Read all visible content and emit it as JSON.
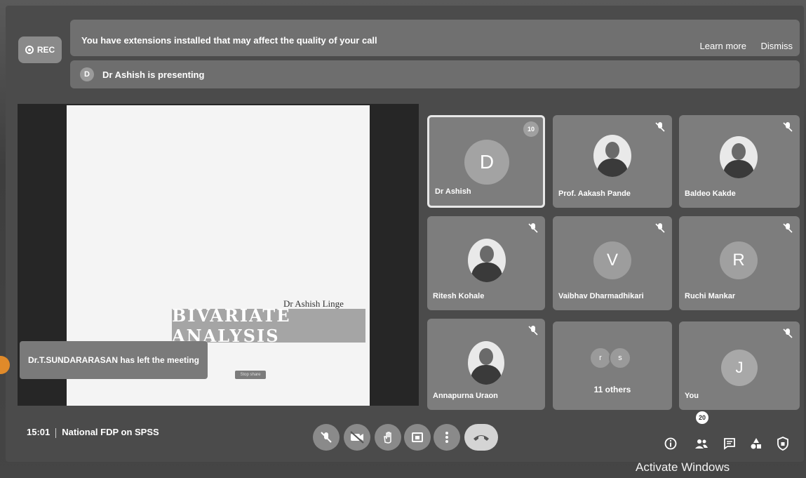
{
  "recording": {
    "label": "REC"
  },
  "banner": {
    "message": "You have extensions installed that may affect the quality of your call",
    "learn_more": "Learn more",
    "dismiss": "Dismiss"
  },
  "presenting": {
    "initial": "D",
    "text": "Dr Ashish is presenting"
  },
  "slide": {
    "author": "Dr Ashish Linge",
    "title": "BIVARIATE ANALYSIS",
    "button_text": "Stop share"
  },
  "toast": {
    "text": "Dr.T.SUNDARARASAN has left the meeting"
  },
  "participants": [
    {
      "name": "Dr Ashish",
      "initial": "D",
      "speaking_badge": "10"
    },
    {
      "name": "Prof. Aakash Pande"
    },
    {
      "name": "Baldeo Kakde"
    },
    {
      "name": "Ritesh Kohale"
    },
    {
      "name": "Vaibhav Dharmadhikari",
      "initial": "V"
    },
    {
      "name": "Ruchi Mankar",
      "initial": "R"
    },
    {
      "name": "Annapurna Uraon"
    },
    {
      "name": "11 others",
      "initials": [
        "r",
        "s"
      ]
    },
    {
      "name": "You",
      "initial": "J"
    }
  ],
  "meeting": {
    "time": "15:01",
    "title": "National FDP on SPSS"
  },
  "people_count": "20",
  "watermark": "Activate Windows"
}
